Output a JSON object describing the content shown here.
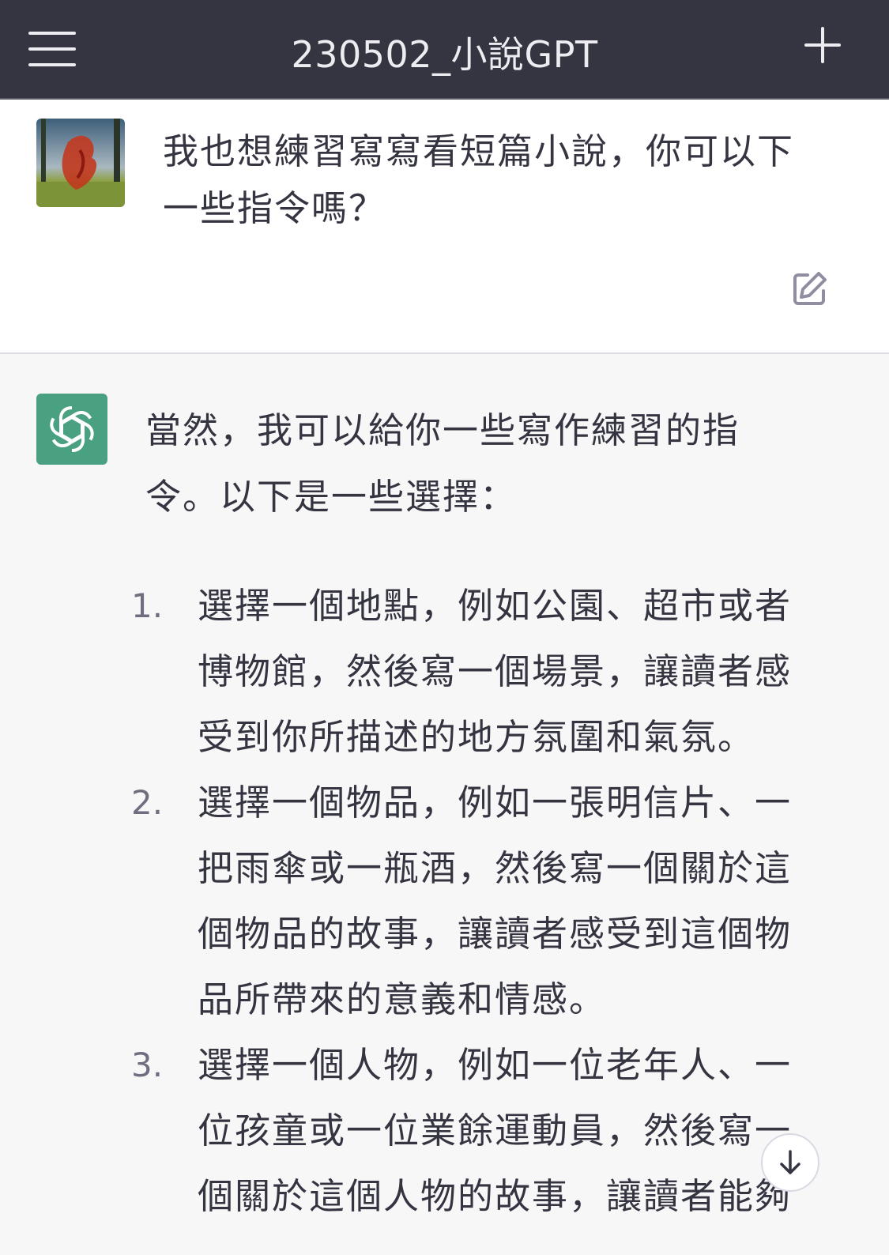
{
  "header": {
    "title": "230502_小說GPT",
    "menu_icon": "hamburger-menu-icon",
    "new_chat_icon": "plus-icon"
  },
  "conversation": {
    "user_message": {
      "avatar": "user-avatar-image",
      "text": "我也想練習寫寫看短篇小說，你可以下一些指令嗎？",
      "edit_icon": "edit-icon"
    },
    "assistant_message": {
      "avatar": "openai-logo-icon",
      "intro": "當然，我可以給你一些寫作練習的指令。以下是一些選擇：",
      "items": [
        {
          "number": "1.",
          "text": "選擇一個地點，例如公園、超市或者博物館，然後寫一個場景，讓讀者感受到你所描述的地方氛圍和氣氛。"
        },
        {
          "number": "2.",
          "text": "選擇一個物品，例如一張明信片、一把雨傘或一瓶酒，然後寫一個關於這個物品的故事，讓讀者感受到這個物品所帶來的意義和情感。"
        },
        {
          "number": "3.",
          "text": "選擇一個人物，例如一位老年人、一位孩童或一位業餘運動員，然後寫一個關於這個人物的故事，讓讀者能夠"
        }
      ]
    },
    "scroll_down_icon": "arrow-down-icon"
  },
  "colors": {
    "header_bg": "#343541",
    "user_bg": "#ffffff",
    "assistant_bg": "#f7f7f8",
    "brand_green": "#4aa181"
  }
}
